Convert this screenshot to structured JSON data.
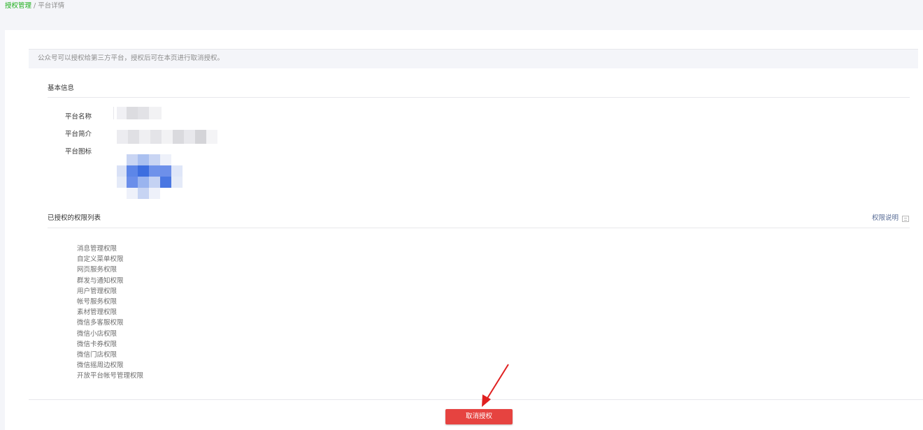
{
  "breadcrumb": {
    "parent": "授权管理",
    "separator": "/",
    "current": "平台详情"
  },
  "notice": "公众号可以授权给第三方平台，授权后可在本页进行取消授权。",
  "basic_info": {
    "title": "基本信息",
    "name_label": "平台名称",
    "intro_label": "平台简介",
    "icon_label": "平台图标"
  },
  "permissions": {
    "title": "已授权的权限列表",
    "help_link": "权限说明",
    "items": [
      "消息管理权限",
      "自定义菜单权限",
      "网页服务权限",
      "群发与通知权限",
      "用户管理权限",
      "帐号服务权限",
      "素材管理权限",
      "微信多客服权限",
      "微信小店权限",
      "微信卡券权限",
      "微信门店权限",
      "微信摇周边权限",
      "开放平台帐号管理权限"
    ]
  },
  "actions": {
    "revoke_label": "取消授权"
  },
  "colors": {
    "accent_green": "#1aad19",
    "danger_red": "#e64340",
    "link_blue": "#576b95",
    "annotation_arrow": "#e02020"
  },
  "icons": {
    "help": "doc-icon",
    "annotation": "red-arrow"
  }
}
